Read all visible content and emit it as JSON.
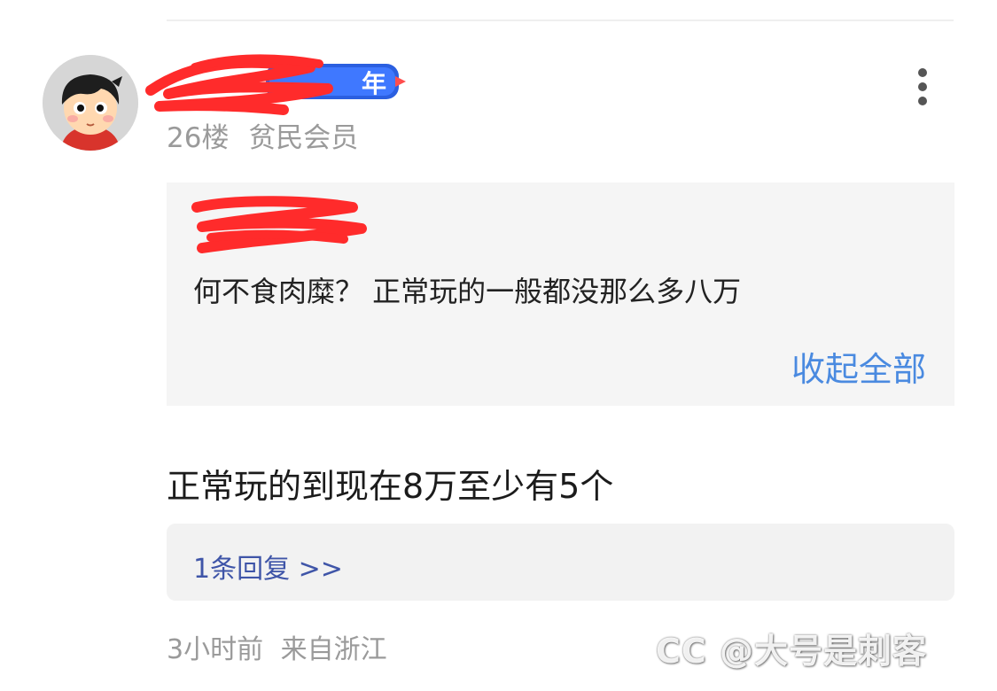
{
  "post": {
    "floor": "26楼",
    "member_level": "贫民会员",
    "badge_text": "年"
  },
  "quote": {
    "text": "何不食肉糜？ 正常玩的一般都没那么多八万",
    "collapse_label": "收起全部"
  },
  "reply": {
    "text": "正常玩的到现在8万至少有5个"
  },
  "replies": {
    "link_label": "1条回复 >>"
  },
  "footer": {
    "time": "3小时前",
    "location": "来自浙江"
  },
  "watermark": {
    "text": "CC @大号是刺客"
  },
  "icons": {
    "avatar": "cartoon-avatar-icon",
    "more": "more-vertical-icon",
    "badge": "anniversary-badge-icon"
  },
  "colors": {
    "link_blue": "#4a8ae0",
    "reply_link": "#3f55a8",
    "meta_gray": "#9a9a9a",
    "redaction_red": "#ff2b2b"
  }
}
